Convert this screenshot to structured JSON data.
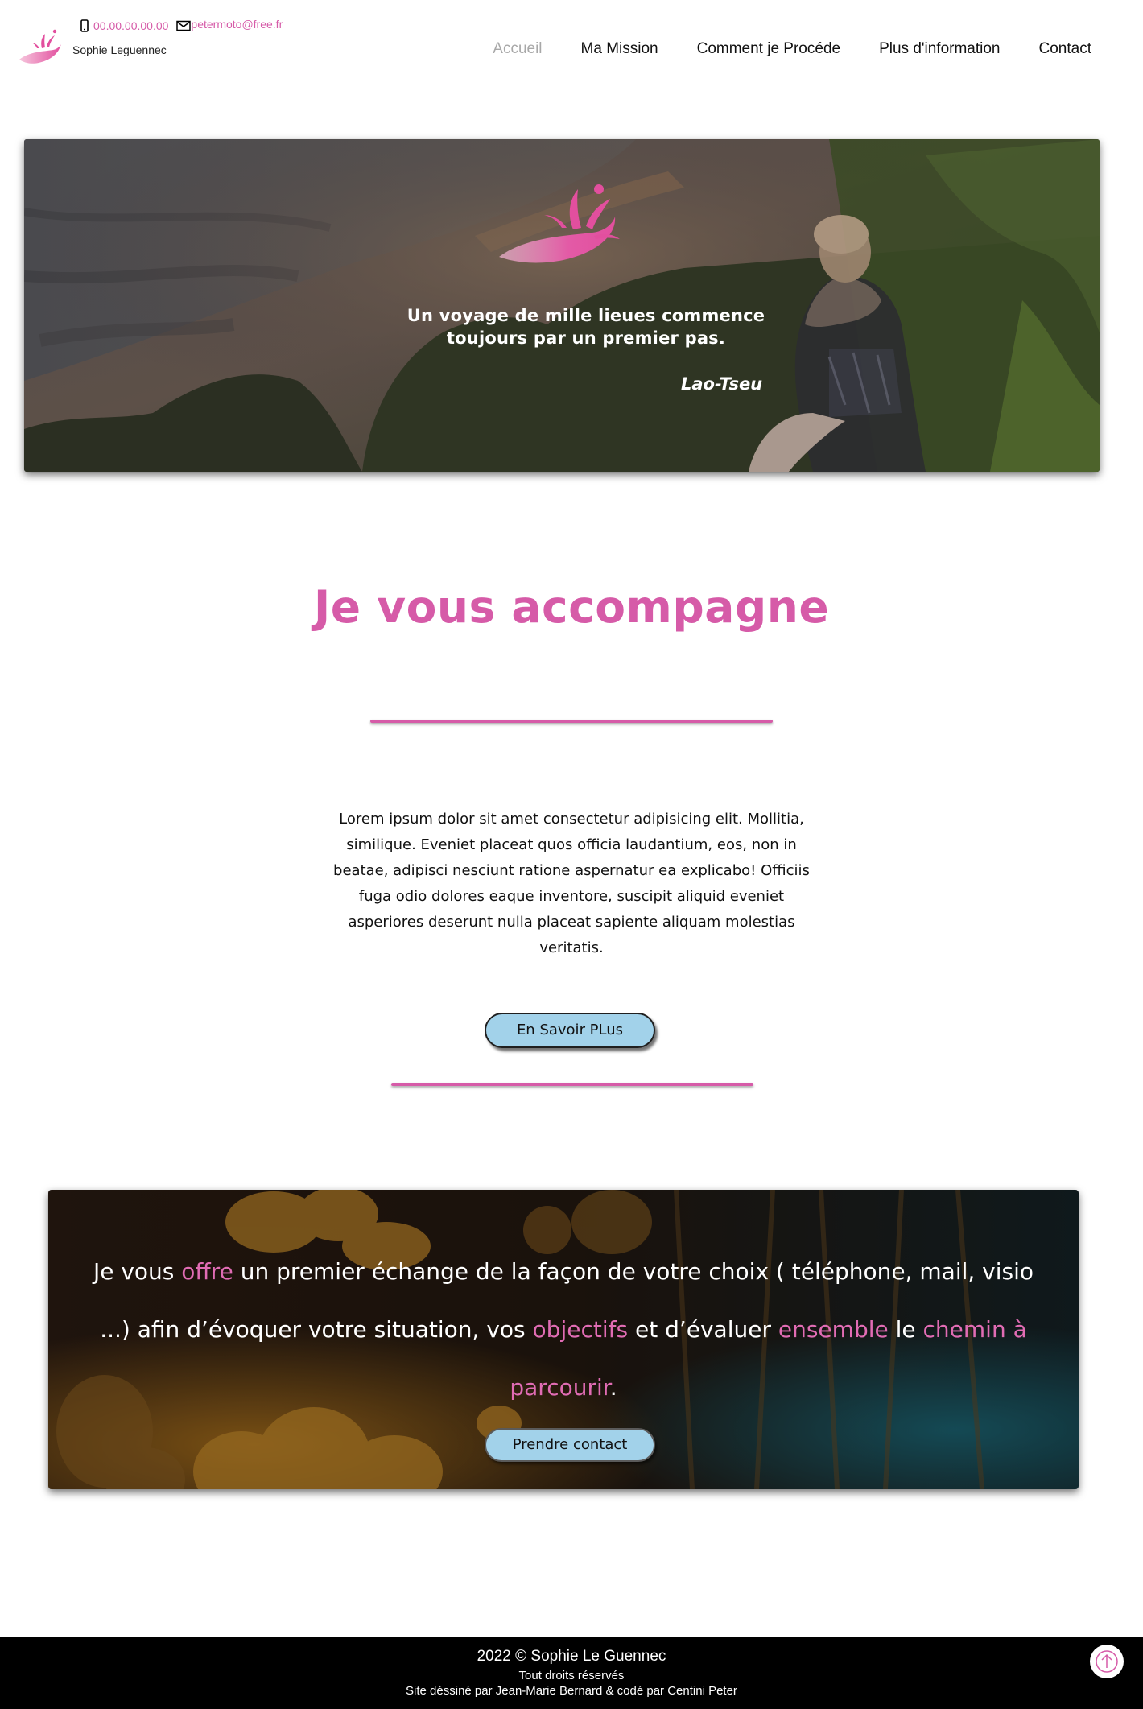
{
  "header": {
    "brand_name": "Sophie Leguennec",
    "phone": "00.00.00.00.00",
    "email": "petermoto@free.fr",
    "nav": [
      {
        "label": "Accueil",
        "active": true
      },
      {
        "label": "Ma Mission"
      },
      {
        "label": "Comment je Procéde"
      },
      {
        "label": "Plus d'information"
      },
      {
        "label": "Contact"
      }
    ]
  },
  "hero": {
    "quote_line1": "Un voyage de mille lieues commence",
    "quote_line2": "toujours par un premier pas.",
    "author": "Lao-Tseu"
  },
  "section": {
    "title": "Je vous accompagne",
    "text": "Lorem ipsum dolor sit amet consectetur adipisicing elit. Mollitia, similique. Eveniet placeat quos officia laudantium, eos, non in beatae, adipisci nesciunt ratione aspernatur ea explicabo! Officiis fuga odio dolores eaque inventore, suscipit aliquid eveniet asperiores deserunt nulla placeat sapiente aliquam molestias veritatis.",
    "button_label": "En Savoir PLus"
  },
  "offer": {
    "parts": [
      "Je vous ",
      "offre",
      " un premier échange de la façon de votre choix ( téléphone, mail, visio ...) afin d’évoquer votre situation, vos ",
      "objectifs",
      " et d’évaluer ",
      "ensemble",
      " le ",
      "chemin à parcourir",
      "."
    ],
    "button_label": "Prendre contact"
  },
  "footer": {
    "copyright": "2022 © Sophie Le Guennec",
    "rights": "Tout droits réservés",
    "credits": "Site déssiné par Jean-Marie Bernard & codé par Centini Peter"
  },
  "colors": {
    "accent_pink": "#d65ba8",
    "button_blue": "#a2d2ea",
    "footer_bg": "#000000"
  },
  "icons": [
    "logo-hand-splash-icon",
    "phone-icon",
    "mail-icon",
    "arrow-up-icon"
  ]
}
